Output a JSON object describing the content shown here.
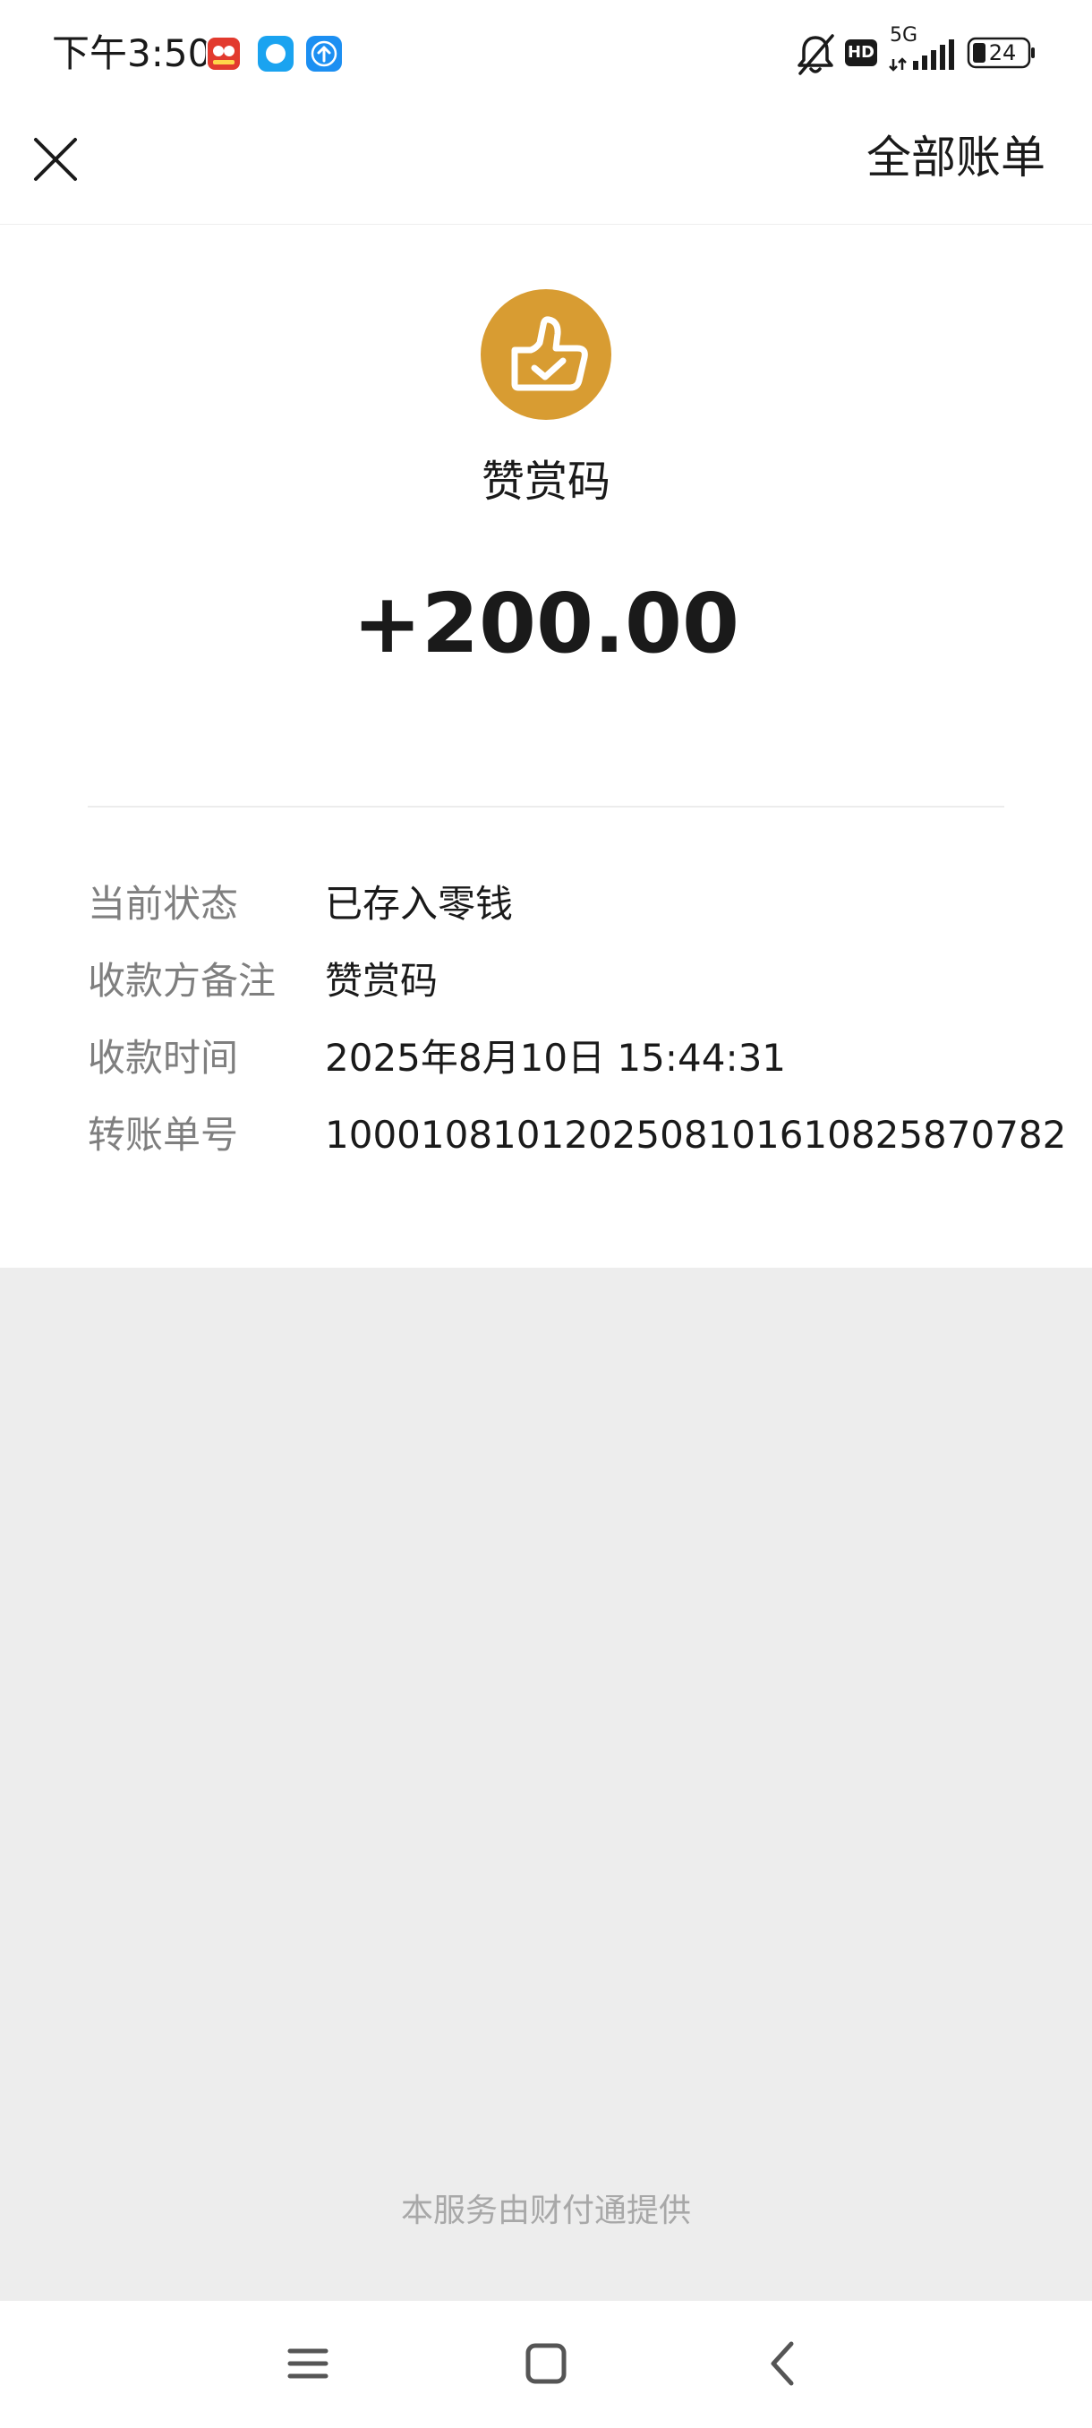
{
  "status_bar": {
    "time": "下午3:50",
    "battery": "24",
    "network": "5G",
    "hd_badge": "HD"
  },
  "header": {
    "close_icon": "close-icon",
    "all_bills_label": "全部账单"
  },
  "transaction": {
    "merchant_icon": "thumbs-up-check-icon",
    "merchant_name": "赞赏码",
    "amount": "+200.00",
    "details": [
      {
        "label": "当前状态",
        "value": "已存入零钱"
      },
      {
        "label": "收款方备注",
        "value": "赞赏码"
      },
      {
        "label": "收款时间",
        "value": "2025年8月10日 15:44:31"
      },
      {
        "label": "转账单号",
        "value": "100010810120250810161082587078​2"
      }
    ]
  },
  "footer": {
    "provider_text": "本服务由财付通提供"
  },
  "nav_bar": {
    "menu_icon": "menu-icon",
    "home_icon": "home-icon",
    "back_icon": "back-icon"
  },
  "colors": {
    "accent_gold": "#d89c32",
    "background_gray": "#ededed",
    "label_gray": "#7f7f7f",
    "footer_gray": "#a8a8a8"
  }
}
